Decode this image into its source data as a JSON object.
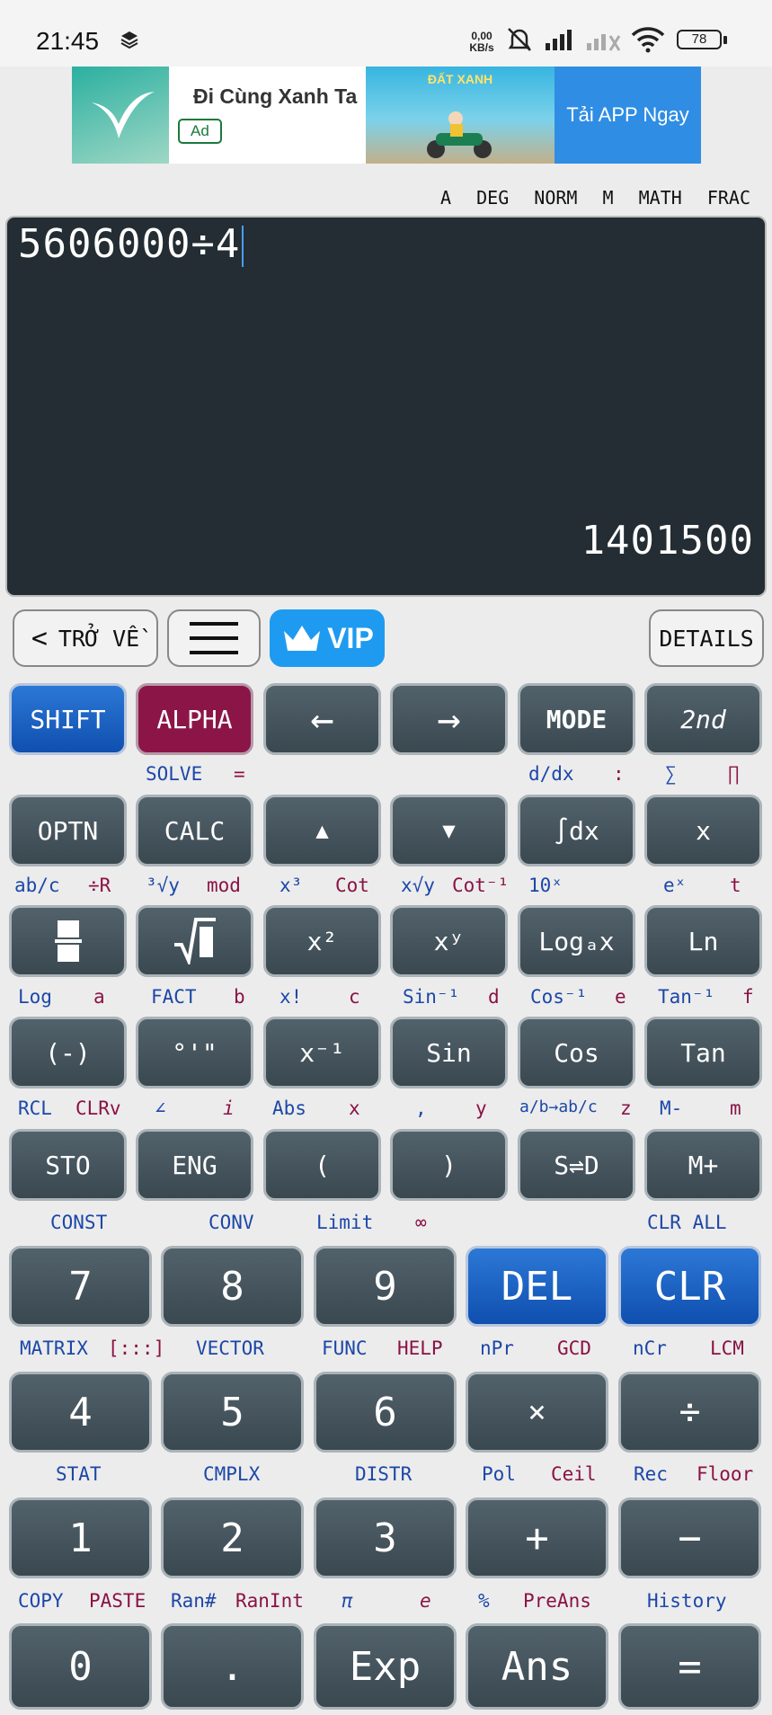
{
  "status": {
    "time": "21:45",
    "net_speed": "0,00 KB/s",
    "battery": "78"
  },
  "ad": {
    "text": "Đi Cùng Xanh Ta",
    "badge": "Ad",
    "banner_title": "ĐẤT XANH",
    "cta": "Tải APP Ngay"
  },
  "modes": [
    "A",
    "DEG",
    "NORM",
    "M",
    "MATH",
    "FRAC"
  ],
  "display": {
    "expression": "5606000÷4",
    "result": "1401500"
  },
  "toolbar": {
    "back": "TRỞ VỀ",
    "vip": "VIP",
    "details": "DETAILS"
  },
  "rows": {
    "r1": {
      "keys": [
        "SHIFT",
        "ALPHA",
        "←",
        "→",
        "MODE",
        "2nd"
      ]
    },
    "r2": {
      "labels": [
        "SOLVE",
        "=",
        "d/dx",
        ":",
        "∑",
        "∏"
      ],
      "keys": [
        "OPTN",
        "CALC",
        "▲",
        "▼",
        "∫dx",
        "x"
      ]
    },
    "r3": {
      "labels": [
        "ab/c",
        "÷R",
        "³√y",
        "mod",
        "x³",
        "Cot",
        "x√y",
        "Cot⁻¹",
        "10ˣ",
        "eˣ",
        "t"
      ],
      "keys": [
        "",
        "",
        "x²",
        "xʸ",
        "Logₐx",
        "Ln"
      ]
    },
    "r4": {
      "labels": [
        "Log",
        "a",
        "FACT",
        "b",
        "x!",
        "c",
        "Sin⁻¹",
        "d",
        "Cos⁻¹",
        "e",
        "Tan⁻¹",
        "f"
      ],
      "keys": [
        "(-)",
        "°'\"",
        "x⁻¹",
        "Sin",
        "Cos",
        "Tan"
      ]
    },
    "r5": {
      "labels": [
        "RCL",
        "CLRv",
        "∠",
        "i",
        "Abs",
        "x",
        ",",
        "y",
        "a/b→ab/c",
        "z",
        "M-",
        "m"
      ],
      "keys": [
        "STO",
        "ENG",
        "(",
        ")",
        "S⇌D",
        "M+"
      ]
    },
    "r6": {
      "labels": [
        "CONST",
        "CONV",
        "Limit",
        "∞",
        "CLR ALL"
      ],
      "keys": [
        "7",
        "8",
        "9",
        "DEL",
        "CLR"
      ]
    },
    "r7": {
      "labels": [
        "MATRIX",
        "[:::]",
        "VECTOR",
        "FUNC",
        "HELP",
        "nPr",
        "GCD",
        "nCr",
        "LCM"
      ],
      "keys": [
        "4",
        "5",
        "6",
        "×",
        "÷"
      ]
    },
    "r8": {
      "labels": [
        "STAT",
        "CMPLX",
        "DISTR",
        "Pol",
        "Ceil",
        "Rec",
        "Floor"
      ],
      "keys": [
        "1",
        "2",
        "3",
        "+",
        "−"
      ]
    },
    "r9": {
      "labels": [
        "COPY",
        "PASTE",
        "Ran#",
        "RanInt",
        "π",
        "e",
        "%",
        "PreAns",
        "History"
      ],
      "keys": [
        "0",
        ".",
        "Exp",
        "Ans",
        "="
      ]
    }
  },
  "colors": {
    "display_bg": "#232d33",
    "key_bg": "#46555d",
    "blue_key": "#1a5fc4",
    "alpha_key": "#8c1548",
    "shift_label": "#1c47a8",
    "alpha_label": "#8a1244"
  }
}
